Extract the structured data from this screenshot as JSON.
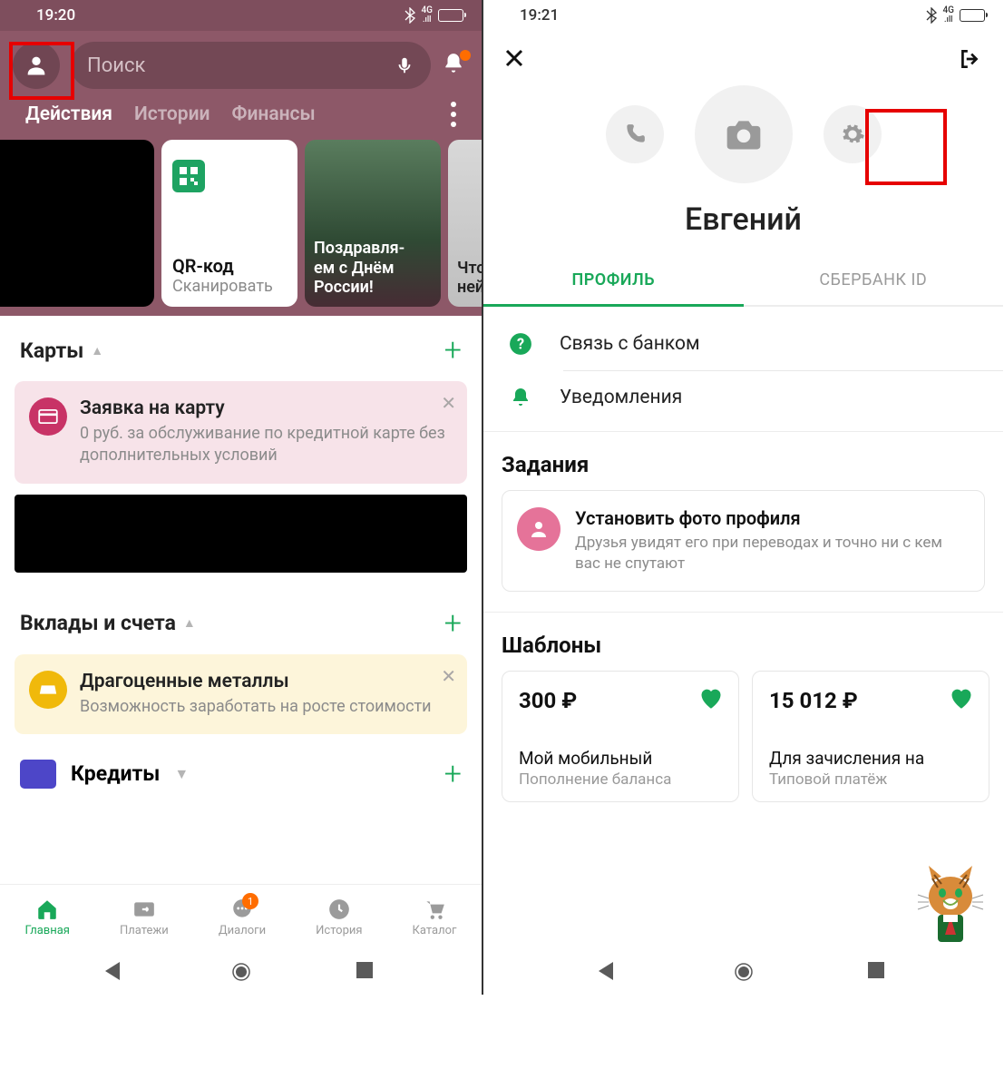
{
  "left": {
    "status": {
      "time": "19:20"
    },
    "search": {
      "placeholder": "Поиск"
    },
    "tabs": [
      "Действия",
      "Истории",
      "Финансы"
    ],
    "stories": [
      {
        "kind": "black"
      },
      {
        "kind": "qr",
        "title": "QR-код",
        "subtitle": "Сканировать"
      },
      {
        "kind": "img1",
        "text": "Поздравля-\nем с Днём\nРоссии!"
      },
      {
        "kind": "img2",
        "text": "Что т\nнейр"
      }
    ],
    "cards_section": "Карты",
    "card_promo": {
      "title": "Заявка на карту",
      "text": "0 руб. за обслуживание по кредитной карте без дополнительных условий"
    },
    "deposits_section": "Вклады и счета",
    "metals_promo": {
      "title": "Драгоценные металлы",
      "text": "Возможность заработать на росте стоимости"
    },
    "credits_section": "Кредиты",
    "nav": [
      {
        "label": "Главная"
      },
      {
        "label": "Платежи"
      },
      {
        "label": "Диалоги",
        "badge": "1"
      },
      {
        "label": "История"
      },
      {
        "label": "Каталог"
      }
    ]
  },
  "right": {
    "status": {
      "time": "19:21"
    },
    "name": "Евгений",
    "tabs": [
      "ПРОФИЛЬ",
      "СБЕРБАНК ID"
    ],
    "menu": [
      {
        "label": "Связь с банком"
      },
      {
        "label": "Уведомления"
      }
    ],
    "tasks_section": "Задания",
    "task": {
      "title": "Установить фото профиля",
      "text": "Друзья увидят его при переводах и точно ни с кем вас не спутают"
    },
    "templates_section": "Шаблоны",
    "templates": [
      {
        "amount": "300 ₽",
        "label": "Мой мобильный",
        "sub": "Пополнение баланса"
      },
      {
        "amount": "15 012 ₽",
        "label": "Для зачисления на",
        "sub": "Типовой платёж"
      }
    ]
  }
}
